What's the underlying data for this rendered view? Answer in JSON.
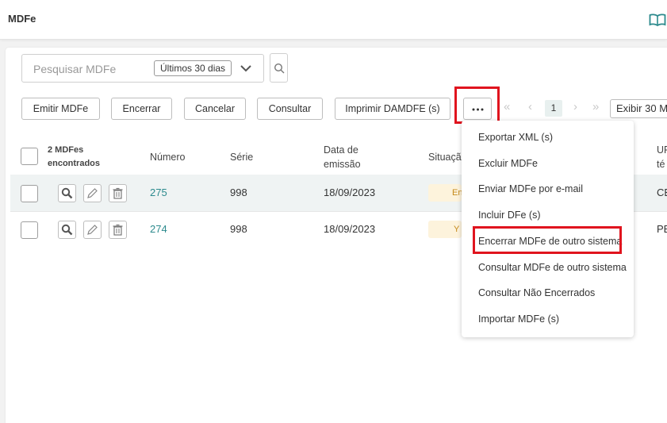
{
  "header": {
    "title": "MDFe",
    "help_icon": "book-open-icon"
  },
  "search": {
    "placeholder": "Pesquisar MDFe",
    "period": "Últimos 30 dias"
  },
  "toolbar": {
    "buttons": [
      "Emitir MDFe",
      "Encerrar",
      "Cancelar",
      "Consultar",
      "Imprimir DAMDFE (s)"
    ],
    "more_label": "..."
  },
  "pagination": {
    "current_page": "1",
    "show": "Exibir 30 M"
  },
  "table": {
    "count_line1": "2 MDFes",
    "count_line2": "encontrados",
    "columns": {
      "numero": "Número",
      "serie": "Série",
      "data_line1": "Data de",
      "data_line2": "emissão",
      "situacao": "Situação",
      "uf_line1": "UF",
      "uf_line2": "té"
    },
    "rows": [
      {
        "numero": "275",
        "serie": "998",
        "data": "18/09/2023",
        "situacao": "En",
        "uf": "CE"
      },
      {
        "numero": "274",
        "serie": "998",
        "data": "18/09/2023",
        "situacao": "Y",
        "uf": "PE"
      }
    ]
  },
  "menu": {
    "items": [
      "Exportar XML (s)",
      "Excluir MDFe",
      "Enviar MDFe por e-mail",
      "Incluir DFe (s)",
      "Encerrar MDFe de outro sistema",
      "Consultar MDFe de outro sistema",
      "Consultar Não Encerrados",
      "Importar MDFe (s)"
    ],
    "highlighted": "Encerrar MDFe de outro sistema"
  },
  "colors": {
    "accent": "#2c8a8d",
    "highlight": "#e0141e",
    "status_bg": "#fdf3dc"
  }
}
